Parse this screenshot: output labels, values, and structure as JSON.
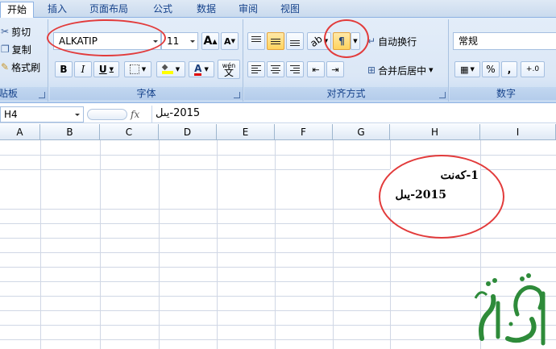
{
  "tabs": [
    {
      "label": "开始",
      "active": true
    },
    {
      "label": "插入",
      "active": false
    },
    {
      "label": "页面布局",
      "active": false
    },
    {
      "label": "公式",
      "active": false
    },
    {
      "label": "数据",
      "active": false
    },
    {
      "label": "审阅",
      "active": false
    },
    {
      "label": "视图",
      "active": false
    }
  ],
  "clipboard": {
    "cut": "剪切",
    "copy": "复制",
    "format_painter": "格式刷",
    "label": "贴板"
  },
  "font": {
    "name": "ALKATIP",
    "size": "11",
    "grow_label": "A",
    "shrink_label": "A",
    "bold": "B",
    "italic": "I",
    "underline": "U",
    "font_color_label": "A",
    "phonetic_top": "wén",
    "phonetic_bottom": "文",
    "label": "字体",
    "font_color": "#e00000",
    "highlight_color": "#ffff00"
  },
  "alignment": {
    "wrap_text": "自动换行",
    "merge_center": "合并后居中",
    "label": "对齐方式",
    "rtl_glyph": "¶"
  },
  "number": {
    "format": "常规",
    "percent": "%",
    "comma": ",",
    "increase_decimal": "+.0",
    "label": "数字"
  },
  "formula_bar": {
    "cell_ref": "H4",
    "fx": "fx",
    "content": "2015-يىل"
  },
  "columns": [
    "A",
    "B",
    "C",
    "D",
    "E",
    "F",
    "G",
    "H",
    "I"
  ],
  "cells": {
    "line1": "1-كەنت",
    "line2": "2015-يىل"
  },
  "watermark": {
    "text": "ئالتۇن",
    "color": "#2e8b3a"
  },
  "colors": {
    "annotation": "#e23b3b",
    "ribbon_border": "#8db2e3"
  }
}
